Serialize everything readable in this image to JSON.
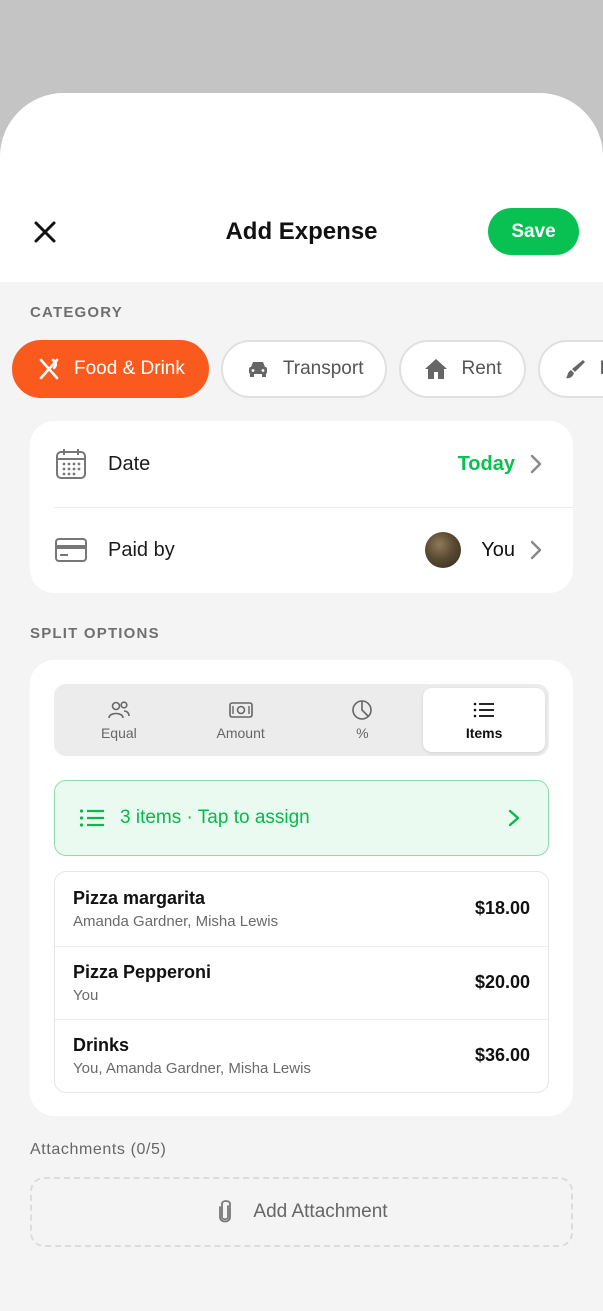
{
  "header": {
    "title": "Add Expense",
    "save_label": "Save"
  },
  "category": {
    "section_label": "CATEGORY",
    "chips": [
      {
        "label": "Food & Drink",
        "icon": "fork-knife-icon",
        "active": true
      },
      {
        "label": "Transport",
        "icon": "car-icon",
        "active": false
      },
      {
        "label": "Rent",
        "icon": "house-icon",
        "active": false
      },
      {
        "label": "Ho",
        "icon": "brush-icon",
        "active": false
      }
    ]
  },
  "details": {
    "date_label": "Date",
    "date_value": "Today",
    "paid_by_label": "Paid by",
    "paid_by_value": "You"
  },
  "split": {
    "section_label": "SPLIT OPTIONS",
    "tabs": [
      {
        "label": "Equal",
        "icon": "people-icon"
      },
      {
        "label": "Amount",
        "icon": "banknote-icon"
      },
      {
        "label": "%",
        "icon": "pie-chart-icon"
      },
      {
        "label": "Items",
        "icon": "list-icon"
      }
    ],
    "active_tab": "Items",
    "assign_text": "3 items · Tap to assign",
    "items": [
      {
        "name": "Pizza margarita",
        "assignees": "Amanda Gardner, Misha Lewis",
        "price": "$18.00"
      },
      {
        "name": "Pizza Pepperoni",
        "assignees": "You",
        "price": "$20.00"
      },
      {
        "name": "Drinks",
        "assignees": "You, Amanda Gardner, Misha Lewis",
        "price": "$36.00"
      }
    ]
  },
  "attachments": {
    "label": "Attachments (0/5)",
    "add_label": "Add Attachment"
  },
  "colors": {
    "accent_green": "#08c152",
    "category_active": "#fb5a1e",
    "assign_bg": "#eafaf0"
  }
}
